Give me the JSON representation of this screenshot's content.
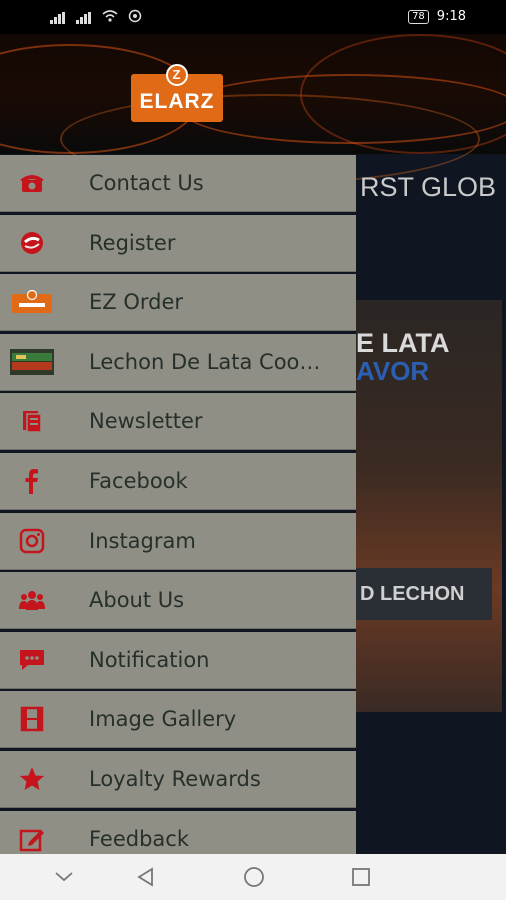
{
  "statusbar": {
    "battery": "78",
    "time": "9:18"
  },
  "app": {
    "logo_text": "ELARZ",
    "logo_badge": "Z",
    "banner_title": "RST GLOB",
    "promo_line1": "E LATA",
    "promo_line2": "AVOR",
    "promo_can": "D LECHON"
  },
  "menu": {
    "items": [
      {
        "label": "Contact Us",
        "icon": "telephone-icon"
      },
      {
        "label": "Register",
        "icon": "register-icon"
      },
      {
        "label": "EZ Order",
        "icon": "elarz-logo-icon"
      },
      {
        "label": "Lechon De Lata Coo…",
        "icon": "lechon-thumbnail-icon"
      },
      {
        "label": "Newsletter",
        "icon": "newsletter-icon"
      },
      {
        "label": "Facebook",
        "icon": "facebook-icon"
      },
      {
        "label": "Instagram",
        "icon": "instagram-icon"
      },
      {
        "label": "About Us",
        "icon": "people-icon"
      },
      {
        "label": "Notification",
        "icon": "chat-bubble-icon"
      },
      {
        "label": "Image Gallery",
        "icon": "film-icon"
      },
      {
        "label": "Loyalty Rewards",
        "icon": "star-icon"
      },
      {
        "label": "Feedback",
        "icon": "edit-icon"
      }
    ]
  },
  "colors": {
    "icon_red": "#c4151c",
    "menu_bg": "#908f86",
    "menu_text": "#26302a",
    "accent_orange": "#e06a16"
  }
}
